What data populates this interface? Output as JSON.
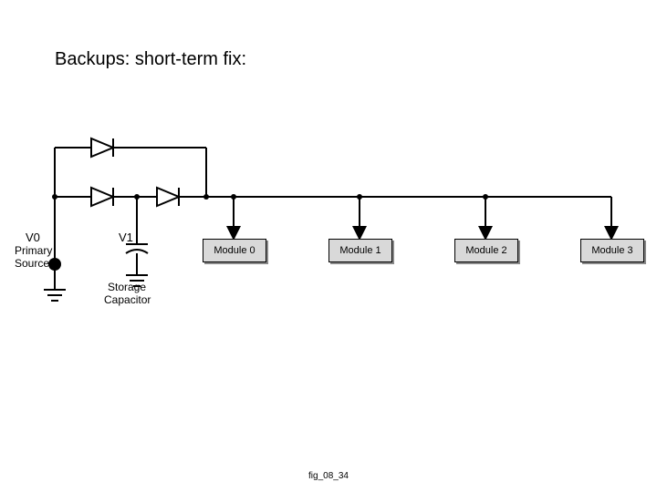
{
  "title": "Backups:  short-term fix:",
  "source": {
    "name": "V0",
    "caption1": "Primary",
    "caption2": "Source"
  },
  "storage": {
    "name": "V1",
    "caption1": "Storage",
    "caption2": "Capacitor"
  },
  "modules": [
    {
      "label": "Module 0"
    },
    {
      "label": "Module 1"
    },
    {
      "label": "Module 2"
    },
    {
      "label": "Module 3"
    }
  ],
  "footer": "fig_08_34"
}
